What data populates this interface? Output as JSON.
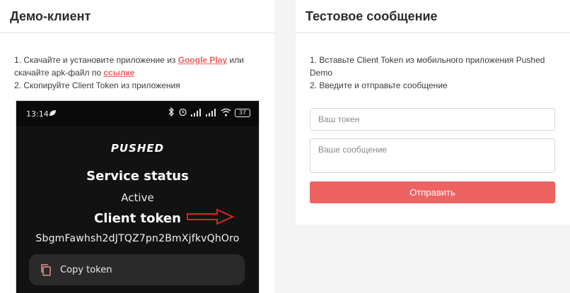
{
  "left_panel": {
    "title": "Демо-клиент",
    "step1_prefix": "1. Скачайте и установите приложение из ",
    "google_play_link": "Google Play",
    "step1_middle": " или скачайте apk-файл по ",
    "apk_link": "ссылке",
    "step2": "2. Скопируйте Client Token из приложения"
  },
  "phone": {
    "status_time": "13:14",
    "battery_level": "37",
    "brand": "PUSHED",
    "service_status_label": "Service status",
    "service_status_value": "Active",
    "client_token_label": "Client token",
    "client_token_value": "SbgmFawhsh2dJTQZ7pn2BmXjfkvQhOro",
    "copy_button_label": "Copy token",
    "arrow_color": "#e0231f"
  },
  "right_panel": {
    "title": "Тестовое сообщение",
    "step1": "1. Вставьте Client Token из мобильного приложения Pushed Demo",
    "step2": "2. Введите и отправьте сообщение",
    "token_placeholder": "Ваш токен",
    "message_placeholder": "Ваше сообщение",
    "send_button_label": "Отправить"
  },
  "colors": {
    "accent": "#ef6262",
    "link": "#ef5f5f",
    "background": "#f4f4f5"
  }
}
